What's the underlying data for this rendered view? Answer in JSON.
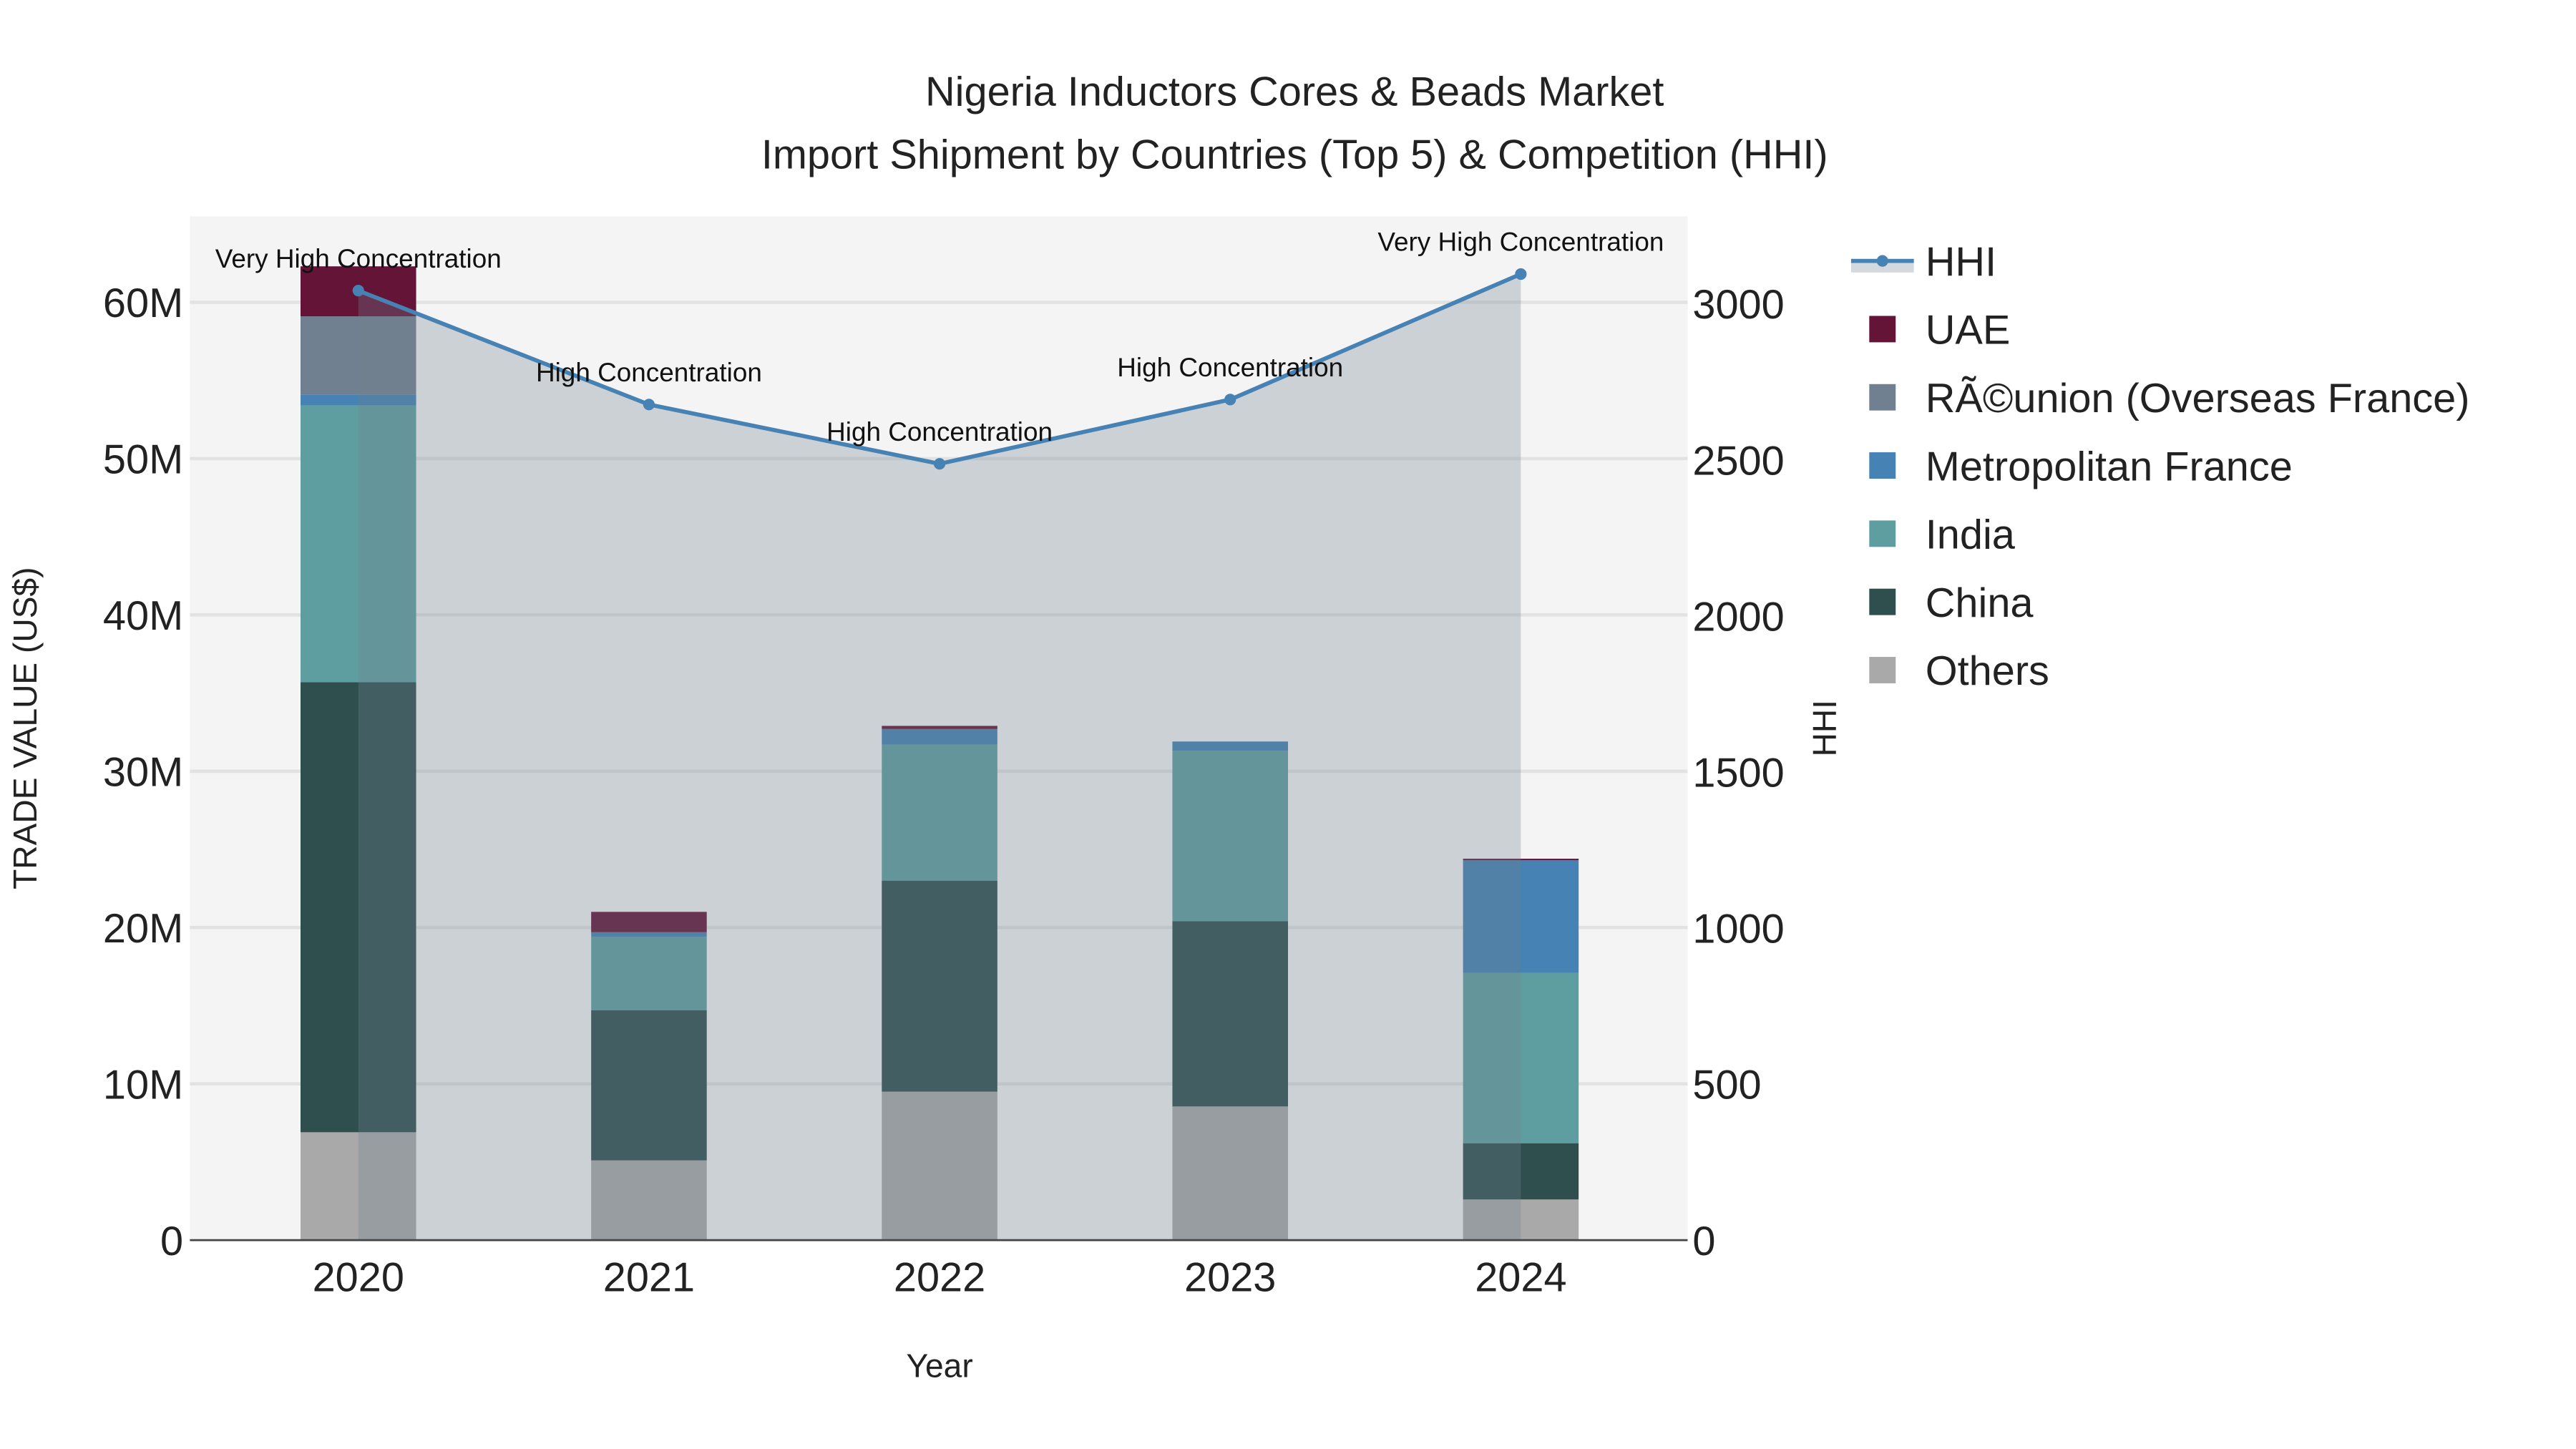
{
  "chart_data": {
    "type": "bar",
    "title": "Nigeria Inductors Cores & Beads Market",
    "subtitle": "Import Shipment by Countries (Top 5) & Competition (HHI)",
    "xlabel": "Year",
    "ylabel": "TRADE VALUE (US$)",
    "y2label": "HHI",
    "categories": [
      "2020",
      "2021",
      "2022",
      "2023",
      "2024"
    ],
    "ylim": [
      0,
      65500000
    ],
    "y2lim": [
      0,
      3280
    ],
    "yticks": [
      0,
      10000000,
      20000000,
      30000000,
      40000000,
      50000000,
      60000000
    ],
    "ytick_labels": [
      "0",
      "10M",
      "20M",
      "30M",
      "40M",
      "50M",
      "60M"
    ],
    "y2ticks": [
      0,
      500,
      1000,
      1500,
      2000,
      2500,
      3000
    ],
    "y2tick_labels": [
      "0",
      "500",
      "1000",
      "1500",
      "2000",
      "2500",
      "3000"
    ],
    "series": [
      {
        "name": "Others",
        "color": "#a9a9a9",
        "values": [
          6900000,
          5100000,
          9500000,
          8550000,
          2600000
        ]
      },
      {
        "name": "China",
        "color": "#2f4f4f",
        "values": [
          28800000,
          9600000,
          13500000,
          11850000,
          3600000
        ]
      },
      {
        "name": "India",
        "color": "#5f9ea0",
        "values": [
          17700000,
          4700000,
          8700000,
          10900000,
          10900000
        ]
      },
      {
        "name": "Metropolitan France",
        "color": "#4682b4",
        "values": [
          700000,
          300000,
          1000000,
          600000,
          7200000
        ]
      },
      {
        "name": "RÃ©union (Overseas France)",
        "color": "#708090",
        "values": [
          5000000,
          0,
          0,
          0,
          0
        ]
      },
      {
        "name": "UAE",
        "color": "#631437",
        "values": [
          3200000,
          1300000,
          200000,
          0,
          100000
        ]
      }
    ],
    "hhi": {
      "name": "HHI",
      "color": "#4682b4",
      "values": [
        3042,
        2677,
        2487,
        2693,
        3095
      ],
      "labels": [
        "Very High Concentration",
        "High Concentration",
        "High Concentration",
        "High Concentration",
        "Very High Concentration"
      ]
    },
    "legend": [
      "HHI",
      "UAE",
      "RÃ©union (Overseas France)",
      "Metropolitan France",
      "India",
      "China",
      "Others"
    ],
    "legend_placement": "right",
    "grid": true
  }
}
